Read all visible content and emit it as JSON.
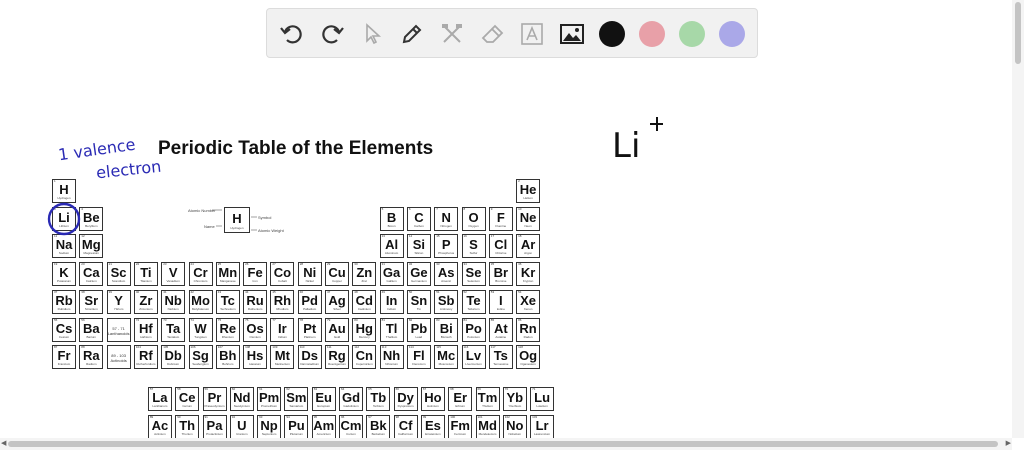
{
  "toolbar": {
    "tools": [
      {
        "id": "undo",
        "icon": "undo-icon"
      },
      {
        "id": "redo",
        "icon": "redo-icon"
      },
      {
        "id": "select",
        "icon": "cursor-icon"
      },
      {
        "id": "pen",
        "icon": "pen-icon"
      },
      {
        "id": "tools",
        "icon": "hammer-icon"
      },
      {
        "id": "eraser",
        "icon": "eraser-icon"
      },
      {
        "id": "text",
        "icon": "text-icon"
      },
      {
        "id": "image",
        "icon": "image-icon"
      }
    ],
    "colors": [
      "#111111",
      "#e8a0a8",
      "#a7d8a8",
      "#aaa8e8"
    ]
  },
  "periodic_table": {
    "title": "Periodic Table of the Elements",
    "key": {
      "symbol": "H",
      "name": "Hydrogen",
      "atomic_number_label": "Atomic Number",
      "symbol_label": "Symbol",
      "name_label": "Name",
      "mass_label": "Atomic Weight"
    },
    "elements": [
      {
        "n": 1,
        "s": "H",
        "name": "Hydrogen",
        "p": 1,
        "g": 1
      },
      {
        "n": 2,
        "s": "He",
        "name": "Helium",
        "p": 1,
        "g": 18
      },
      {
        "n": 3,
        "s": "Li",
        "name": "Lithium",
        "p": 2,
        "g": 1
      },
      {
        "n": 4,
        "s": "Be",
        "name": "Beryllium",
        "p": 2,
        "g": 2
      },
      {
        "n": 5,
        "s": "B",
        "name": "Boron",
        "p": 2,
        "g": 13
      },
      {
        "n": 6,
        "s": "C",
        "name": "Carbon",
        "p": 2,
        "g": 14
      },
      {
        "n": 7,
        "s": "N",
        "name": "Nitrogen",
        "p": 2,
        "g": 15
      },
      {
        "n": 8,
        "s": "O",
        "name": "Oxygen",
        "p": 2,
        "g": 16
      },
      {
        "n": 9,
        "s": "F",
        "name": "Fluorine",
        "p": 2,
        "g": 17
      },
      {
        "n": 10,
        "s": "Ne",
        "name": "Neon",
        "p": 2,
        "g": 18
      },
      {
        "n": 11,
        "s": "Na",
        "name": "Sodium",
        "p": 3,
        "g": 1
      },
      {
        "n": 12,
        "s": "Mg",
        "name": "Magnesium",
        "p": 3,
        "g": 2
      },
      {
        "n": 13,
        "s": "Al",
        "name": "Aluminum",
        "p": 3,
        "g": 13
      },
      {
        "n": 14,
        "s": "Si",
        "name": "Silicon",
        "p": 3,
        "g": 14
      },
      {
        "n": 15,
        "s": "P",
        "name": "Phosphorus",
        "p": 3,
        "g": 15
      },
      {
        "n": 16,
        "s": "S",
        "name": "Sulfur",
        "p": 3,
        "g": 16
      },
      {
        "n": 17,
        "s": "Cl",
        "name": "Chlorine",
        "p": 3,
        "g": 17
      },
      {
        "n": 18,
        "s": "Ar",
        "name": "Argon",
        "p": 3,
        "g": 18
      },
      {
        "n": 19,
        "s": "K",
        "name": "Potassium",
        "p": 4,
        "g": 1
      },
      {
        "n": 20,
        "s": "Ca",
        "name": "Calcium",
        "p": 4,
        "g": 2
      },
      {
        "n": 21,
        "s": "Sc",
        "name": "Scandium",
        "p": 4,
        "g": 3
      },
      {
        "n": 22,
        "s": "Ti",
        "name": "Titanium",
        "p": 4,
        "g": 4
      },
      {
        "n": 23,
        "s": "V",
        "name": "Vanadium",
        "p": 4,
        "g": 5
      },
      {
        "n": 24,
        "s": "Cr",
        "name": "Chromium",
        "p": 4,
        "g": 6
      },
      {
        "n": 25,
        "s": "Mn",
        "name": "Manganese",
        "p": 4,
        "g": 7
      },
      {
        "n": 26,
        "s": "Fe",
        "name": "Iron",
        "p": 4,
        "g": 8
      },
      {
        "n": 27,
        "s": "Co",
        "name": "Cobalt",
        "p": 4,
        "g": 9
      },
      {
        "n": 28,
        "s": "Ni",
        "name": "Nickel",
        "p": 4,
        "g": 10
      },
      {
        "n": 29,
        "s": "Cu",
        "name": "Copper",
        "p": 4,
        "g": 11
      },
      {
        "n": 30,
        "s": "Zn",
        "name": "Zinc",
        "p": 4,
        "g": 12
      },
      {
        "n": 31,
        "s": "Ga",
        "name": "Gallium",
        "p": 4,
        "g": 13
      },
      {
        "n": 32,
        "s": "Ge",
        "name": "Germanium",
        "p": 4,
        "g": 14
      },
      {
        "n": 33,
        "s": "As",
        "name": "Arsenic",
        "p": 4,
        "g": 15
      },
      {
        "n": 34,
        "s": "Se",
        "name": "Selenium",
        "p": 4,
        "g": 16
      },
      {
        "n": 35,
        "s": "Br",
        "name": "Bromine",
        "p": 4,
        "g": 17
      },
      {
        "n": 36,
        "s": "Kr",
        "name": "Krypton",
        "p": 4,
        "g": 18
      },
      {
        "n": 37,
        "s": "Rb",
        "name": "Rubidium",
        "p": 5,
        "g": 1
      },
      {
        "n": 38,
        "s": "Sr",
        "name": "Strontium",
        "p": 5,
        "g": 2
      },
      {
        "n": 39,
        "s": "Y",
        "name": "Yttrium",
        "p": 5,
        "g": 3
      },
      {
        "n": 40,
        "s": "Zr",
        "name": "Zirconium",
        "p": 5,
        "g": 4
      },
      {
        "n": 41,
        "s": "Nb",
        "name": "Niobium",
        "p": 5,
        "g": 5
      },
      {
        "n": 42,
        "s": "Mo",
        "name": "Molybdenum",
        "p": 5,
        "g": 6
      },
      {
        "n": 43,
        "s": "Tc",
        "name": "Technetium",
        "p": 5,
        "g": 7
      },
      {
        "n": 44,
        "s": "Ru",
        "name": "Ruthenium",
        "p": 5,
        "g": 8
      },
      {
        "n": 45,
        "s": "Rh",
        "name": "Rhodium",
        "p": 5,
        "g": 9
      },
      {
        "n": 46,
        "s": "Pd",
        "name": "Palladium",
        "p": 5,
        "g": 10
      },
      {
        "n": 47,
        "s": "Ag",
        "name": "Silver",
        "p": 5,
        "g": 11
      },
      {
        "n": 48,
        "s": "Cd",
        "name": "Cadmium",
        "p": 5,
        "g": 12
      },
      {
        "n": 49,
        "s": "In",
        "name": "Indium",
        "p": 5,
        "g": 13
      },
      {
        "n": 50,
        "s": "Sn",
        "name": "Tin",
        "p": 5,
        "g": 14
      },
      {
        "n": 51,
        "s": "Sb",
        "name": "Antimony",
        "p": 5,
        "g": 15
      },
      {
        "n": 52,
        "s": "Te",
        "name": "Tellurium",
        "p": 5,
        "g": 16
      },
      {
        "n": 53,
        "s": "I",
        "name": "Iodine",
        "p": 5,
        "g": 17
      },
      {
        "n": 54,
        "s": "Xe",
        "name": "Xenon",
        "p": 5,
        "g": 18
      },
      {
        "n": 55,
        "s": "Cs",
        "name": "Cesium",
        "p": 6,
        "g": 1
      },
      {
        "n": 56,
        "s": "Ba",
        "name": "Barium",
        "p": 6,
        "g": 2
      },
      {
        "n": 0,
        "s": "",
        "name": "",
        "sub": "57 - 71",
        "sub2": "Lanthanoids",
        "p": 6,
        "g": 3
      },
      {
        "n": 72,
        "s": "Hf",
        "name": "Hafnium",
        "p": 6,
        "g": 4
      },
      {
        "n": 73,
        "s": "Ta",
        "name": "Tantalum",
        "p": 6,
        "g": 5
      },
      {
        "n": 74,
        "s": "W",
        "name": "Tungsten",
        "p": 6,
        "g": 6
      },
      {
        "n": 75,
        "s": "Re",
        "name": "Rhenium",
        "p": 6,
        "g": 7
      },
      {
        "n": 76,
        "s": "Os",
        "name": "Osmium",
        "p": 6,
        "g": 8
      },
      {
        "n": 77,
        "s": "Ir",
        "name": "Iridium",
        "p": 6,
        "g": 9
      },
      {
        "n": 78,
        "s": "Pt",
        "name": "Platinum",
        "p": 6,
        "g": 10
      },
      {
        "n": 79,
        "s": "Au",
        "name": "Gold",
        "p": 6,
        "g": 11
      },
      {
        "n": 80,
        "s": "Hg",
        "name": "Mercury",
        "p": 6,
        "g": 12
      },
      {
        "n": 81,
        "s": "Tl",
        "name": "Thallium",
        "p": 6,
        "g": 13
      },
      {
        "n": 82,
        "s": "Pb",
        "name": "Lead",
        "p": 6,
        "g": 14
      },
      {
        "n": 83,
        "s": "Bi",
        "name": "Bismuth",
        "p": 6,
        "g": 15
      },
      {
        "n": 84,
        "s": "Po",
        "name": "Polonium",
        "p": 6,
        "g": 16
      },
      {
        "n": 85,
        "s": "At",
        "name": "Astatine",
        "p": 6,
        "g": 17
      },
      {
        "n": 86,
        "s": "Rn",
        "name": "Radon",
        "p": 6,
        "g": 18
      },
      {
        "n": 87,
        "s": "Fr",
        "name": "Francium",
        "p": 7,
        "g": 1
      },
      {
        "n": 88,
        "s": "Ra",
        "name": "Radium",
        "p": 7,
        "g": 2
      },
      {
        "n": 0,
        "s": "",
        "name": "",
        "sub": "89 - 103",
        "sub2": "Actinoids",
        "p": 7,
        "g": 3
      },
      {
        "n": 104,
        "s": "Rf",
        "name": "Rutherfordium",
        "p": 7,
        "g": 4
      },
      {
        "n": 105,
        "s": "Db",
        "name": "Dubnium",
        "p": 7,
        "g": 5
      },
      {
        "n": 106,
        "s": "Sg",
        "name": "Seaborgium",
        "p": 7,
        "g": 6
      },
      {
        "n": 107,
        "s": "Bh",
        "name": "Bohrium",
        "p": 7,
        "g": 7
      },
      {
        "n": 108,
        "s": "Hs",
        "name": "Hassium",
        "p": 7,
        "g": 8
      },
      {
        "n": 109,
        "s": "Mt",
        "name": "Meitnerium",
        "p": 7,
        "g": 9
      },
      {
        "n": 110,
        "s": "Ds",
        "name": "Darmstadtium",
        "p": 7,
        "g": 10
      },
      {
        "n": 111,
        "s": "Rg",
        "name": "Roentgenium",
        "p": 7,
        "g": 11
      },
      {
        "n": 112,
        "s": "Cn",
        "name": "Copernicium",
        "p": 7,
        "g": 12
      },
      {
        "n": 113,
        "s": "Nh",
        "name": "Nihonium",
        "p": 7,
        "g": 13
      },
      {
        "n": 114,
        "s": "Fl",
        "name": "Flerovium",
        "p": 7,
        "g": 14
      },
      {
        "n": 115,
        "s": "Mc",
        "name": "Moscovium",
        "p": 7,
        "g": 15
      },
      {
        "n": 116,
        "s": "Lv",
        "name": "Livermorium",
        "p": 7,
        "g": 16
      },
      {
        "n": 117,
        "s": "Ts",
        "name": "Tennessine",
        "p": 7,
        "g": 17
      },
      {
        "n": 118,
        "s": "Og",
        "name": "Oganesson",
        "p": 7,
        "g": 18
      },
      {
        "n": 57,
        "s": "La",
        "name": "Lanthanum",
        "p": 9,
        "g": 4
      },
      {
        "n": 58,
        "s": "Ce",
        "name": "Cerium",
        "p": 9,
        "g": 5
      },
      {
        "n": 59,
        "s": "Pr",
        "name": "Praseodymium",
        "p": 9,
        "g": 6
      },
      {
        "n": 60,
        "s": "Nd",
        "name": "Neodymium",
        "p": 9,
        "g": 7
      },
      {
        "n": 61,
        "s": "Pm",
        "name": "Promethium",
        "p": 9,
        "g": 8
      },
      {
        "n": 62,
        "s": "Sm",
        "name": "Samarium",
        "p": 9,
        "g": 9
      },
      {
        "n": 63,
        "s": "Eu",
        "name": "Europium",
        "p": 9,
        "g": 10
      },
      {
        "n": 64,
        "s": "Gd",
        "name": "Gadolinium",
        "p": 9,
        "g": 11
      },
      {
        "n": 65,
        "s": "Tb",
        "name": "Terbium",
        "p": 9,
        "g": 12
      },
      {
        "n": 66,
        "s": "Dy",
        "name": "Dysprosium",
        "p": 9,
        "g": 13
      },
      {
        "n": 67,
        "s": "Ho",
        "name": "Holmium",
        "p": 9,
        "g": 14
      },
      {
        "n": 68,
        "s": "Er",
        "name": "Erbium",
        "p": 9,
        "g": 15
      },
      {
        "n": 69,
        "s": "Tm",
        "name": "Thulium",
        "p": 9,
        "g": 16
      },
      {
        "n": 70,
        "s": "Yb",
        "name": "Ytterbium",
        "p": 9,
        "g": 17
      },
      {
        "n": 71,
        "s": "Lu",
        "name": "Lutetium",
        "p": 9,
        "g": 18
      },
      {
        "n": 89,
        "s": "Ac",
        "name": "Actinium",
        "p": 10,
        "g": 4
      },
      {
        "n": 90,
        "s": "Th",
        "name": "Thorium",
        "p": 10,
        "g": 5
      },
      {
        "n": 91,
        "s": "Pa",
        "name": "Protactinium",
        "p": 10,
        "g": 6
      },
      {
        "n": 92,
        "s": "U",
        "name": "Uranium",
        "p": 10,
        "g": 7
      },
      {
        "n": 93,
        "s": "Np",
        "name": "Neptunium",
        "p": 10,
        "g": 8
      },
      {
        "n": 94,
        "s": "Pu",
        "name": "Plutonium",
        "p": 10,
        "g": 9
      },
      {
        "n": 95,
        "s": "Am",
        "name": "Americium",
        "p": 10,
        "g": 10
      },
      {
        "n": 96,
        "s": "Cm",
        "name": "Curium",
        "p": 10,
        "g": 11
      },
      {
        "n": 97,
        "s": "Bk",
        "name": "Berkelium",
        "p": 10,
        "g": 12
      },
      {
        "n": 98,
        "s": "Cf",
        "name": "Californium",
        "p": 10,
        "g": 13
      },
      {
        "n": 99,
        "s": "Es",
        "name": "Einsteinium",
        "p": 10,
        "g": 14
      },
      {
        "n": 100,
        "s": "Fm",
        "name": "Fermium",
        "p": 10,
        "g": 15
      },
      {
        "n": 101,
        "s": "Md",
        "name": "Mendelevium",
        "p": 10,
        "g": 16
      },
      {
        "n": 102,
        "s": "No",
        "name": "Nobelium",
        "p": 10,
        "g": 17
      },
      {
        "n": 103,
        "s": "Lr",
        "name": "Lawrencium",
        "p": 10,
        "g": 18
      }
    ]
  },
  "annotations": {
    "valence_line1": "1 valence",
    "valence_line2": "electron",
    "ion_base": "Li",
    "ion_charge": "+",
    "ink_color": "#2a2ab4"
  }
}
